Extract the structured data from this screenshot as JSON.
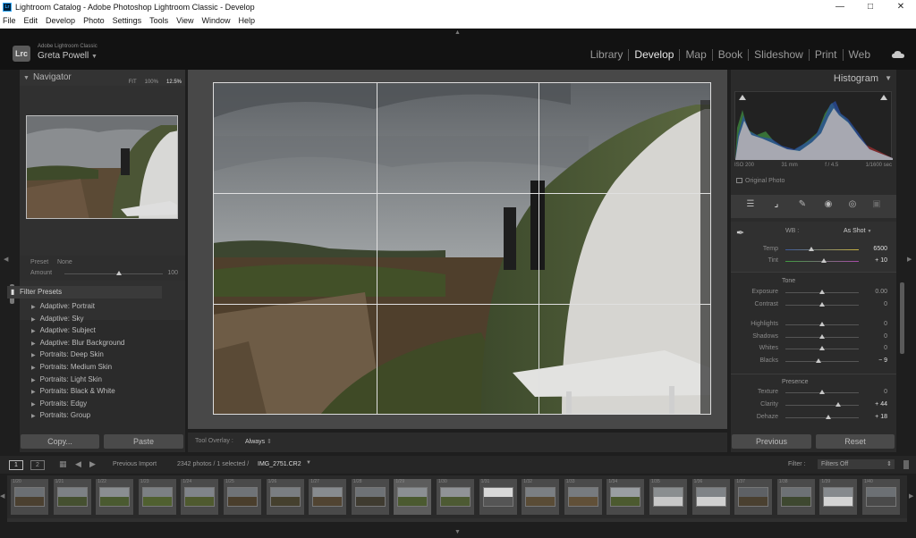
{
  "window": {
    "title": "Lightroom Catalog - Adobe Photoshop Lightroom Classic - Develop",
    "app_icon": "Lr",
    "controls": [
      "minimize-icon",
      "maximize-icon",
      "close-icon"
    ]
  },
  "menu": [
    "File",
    "Edit",
    "Develop",
    "Photo",
    "Settings",
    "Tools",
    "View",
    "Window",
    "Help"
  ],
  "identity": {
    "logo": "Lrc",
    "product": "Adobe Lightroom Classic",
    "user": "Greta Powell"
  },
  "modules": [
    "Library",
    "Develop",
    "Map",
    "Book",
    "Slideshow",
    "Print",
    "Web"
  ],
  "active_module": "Develop",
  "navigator": {
    "title": "Navigator",
    "zoom_options": [
      "FIT",
      "100%",
      "12.5%"
    ],
    "selected_zoom": "12.5%"
  },
  "presets": {
    "preset_label": "Preset",
    "preset_value": "None",
    "amount_label": "Amount",
    "amount_value": "100",
    "amount_level": 0.55
  },
  "filter_presets": {
    "label": "Filter Presets",
    "items": [
      "Adaptive: Portrait",
      "Adaptive: Sky",
      "Adaptive: Subject",
      "Adaptive: Blur Background",
      "Portraits: Deep Skin",
      "Portraits: Medium Skin",
      "Portraits: Light Skin",
      "Portraits: Black & White",
      "Portraits: Edgy",
      "Portraits: Group"
    ]
  },
  "left_buttons": {
    "copy": "Copy...",
    "paste": "Paste"
  },
  "toolbar": {
    "overlay_label": "Tool Overlay :",
    "overlay_value": "Always"
  },
  "histogram": {
    "title": "Histogram",
    "iso": "ISO 200",
    "focal": "31 mm",
    "aperture": "f / 4.5",
    "shutter": "1/1600 sec",
    "original_label": "Original Photo"
  },
  "tools": [
    "sliders-icon",
    "crop-icon",
    "healing-icon",
    "red-eye-icon",
    "mask-icon",
    "presets-icon"
  ],
  "basic": {
    "wb_label": "WB :",
    "wb_value": "As Shot",
    "tone_label": "Tone",
    "presence_label": "Presence",
    "sliders": [
      {
        "label": "Temp",
        "value": "6500",
        "level": 0.35
      },
      {
        "label": "Tint",
        "value": "+ 10",
        "level": 0.52
      },
      {
        "label": "Exposure",
        "value": "0.00",
        "level": 0.5
      },
      {
        "label": "Contrast",
        "value": "0",
        "level": 0.5
      },
      {
        "label": "Highlights",
        "value": "0",
        "level": 0.5
      },
      {
        "label": "Shadows",
        "value": "0",
        "level": 0.5
      },
      {
        "label": "Whites",
        "value": "0",
        "level": 0.5
      },
      {
        "label": "Blacks",
        "value": "− 9",
        "level": 0.45
      },
      {
        "label": "Texture",
        "value": "0",
        "level": 0.5
      },
      {
        "label": "Clarity",
        "value": "+ 44",
        "level": 0.72
      },
      {
        "label": "Dehaze",
        "value": "+ 18",
        "level": 0.59
      }
    ]
  },
  "right_buttons": {
    "previous": "Previous",
    "reset": "Reset"
  },
  "filmstrip_bar": {
    "view1": "1",
    "view2": "2",
    "source": "Previous Import",
    "count": "2342 photos / 1 selected /",
    "filename": "IMG_2751.CR2",
    "filter_label": "Filter :",
    "filter_value": "Filters Off"
  },
  "filmstrip": {
    "numbers": [
      "1/20",
      "1/21",
      "1/22",
      "1/23",
      "1/24",
      "1/25",
      "1/26",
      "1/27",
      "1/28",
      "1/29",
      "1/30",
      "1/31",
      "1/32",
      "1/33",
      "1/34",
      "1/35",
      "1/36",
      "1/37",
      "1/38",
      "1/39",
      "1/40"
    ],
    "selected_index": 9
  }
}
